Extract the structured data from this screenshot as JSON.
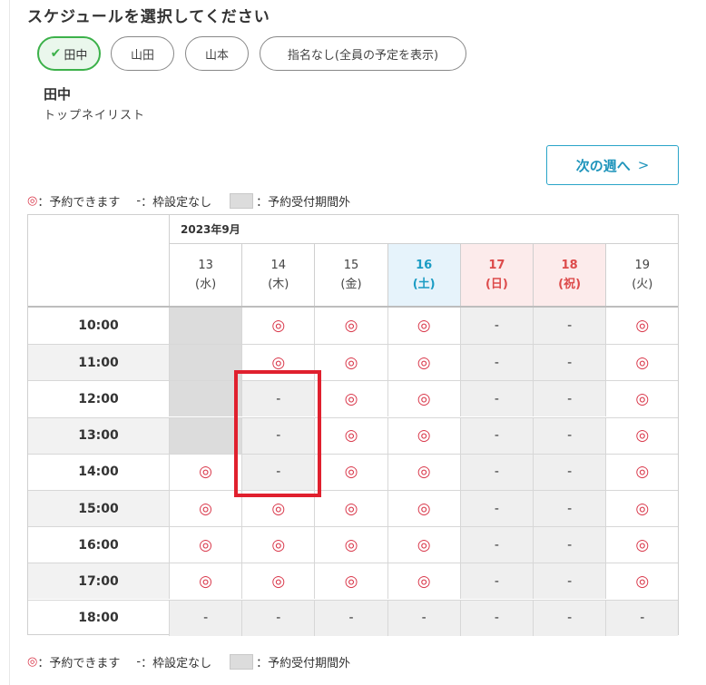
{
  "title": "スケジュールを選択してください",
  "staff": [
    {
      "label": "田中",
      "active": true
    },
    {
      "label": "山田",
      "active": false
    },
    {
      "label": "山本",
      "active": false
    },
    {
      "label": "指名なし(全員の予定を表示)",
      "active": false
    }
  ],
  "selected_staff": {
    "name": "田中",
    "role": "トップネイリスト"
  },
  "next_week_label": "次の週へ",
  "next_week_arrow": ">",
  "legend": {
    "ok_symbol": "◎",
    "ok_text": "：予約できます",
    "none_symbol": "-",
    "none_text": "：枠設定なし",
    "out_text": "：予約受付期間外"
  },
  "calendar": {
    "month": "2023年9月",
    "days": [
      {
        "day": "13",
        "weekday": "(水)",
        "type": "normal"
      },
      {
        "day": "14",
        "weekday": "(木)",
        "type": "normal"
      },
      {
        "day": "15",
        "weekday": "(金)",
        "type": "normal"
      },
      {
        "day": "16",
        "weekday": "(土)",
        "type": "saturday"
      },
      {
        "day": "17",
        "weekday": "(日)",
        "type": "holiday"
      },
      {
        "day": "18",
        "weekday": "(祝)",
        "type": "holiday"
      },
      {
        "day": "19",
        "weekday": "(火)",
        "type": "normal"
      }
    ],
    "times": [
      "10:00",
      "11:00",
      "12:00",
      "13:00",
      "14:00",
      "15:00",
      "16:00",
      "17:00",
      "18:00"
    ],
    "slots": [
      [
        "out",
        "ok",
        "ok",
        "ok",
        "none",
        "none",
        "ok"
      ],
      [
        "out",
        "ok",
        "ok",
        "ok",
        "none",
        "none",
        "ok"
      ],
      [
        "out",
        "none",
        "ok",
        "ok",
        "none",
        "none",
        "ok"
      ],
      [
        "out",
        "none",
        "ok",
        "ok",
        "none",
        "none",
        "ok"
      ],
      [
        "ok",
        "none",
        "ok",
        "ok",
        "none",
        "none",
        "ok"
      ],
      [
        "ok",
        "ok",
        "ok",
        "ok",
        "none",
        "none",
        "ok"
      ],
      [
        "ok",
        "ok",
        "ok",
        "ok",
        "none",
        "none",
        "ok"
      ],
      [
        "ok",
        "ok",
        "ok",
        "ok",
        "none",
        "none",
        "ok"
      ],
      [
        "none",
        "none",
        "none",
        "none",
        "none",
        "none",
        "none"
      ]
    ]
  },
  "colors": {
    "accent_green": "#3cb14a",
    "accent_blue": "#1e94bb",
    "ok_red": "#d9374a",
    "highlight_red": "#e0202e"
  }
}
